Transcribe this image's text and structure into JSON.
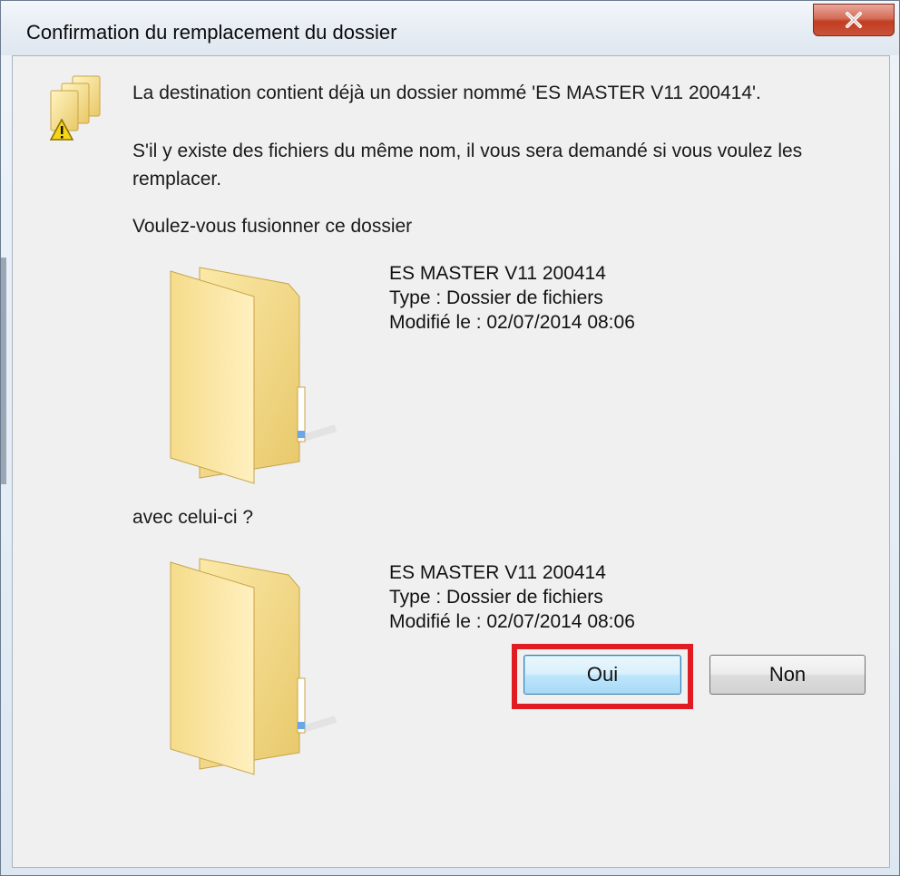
{
  "window": {
    "title": "Confirmation du remplacement du dossier"
  },
  "message": {
    "line1": "La destination contient déjà un dossier nommé 'ES MASTER V11 200414'.",
    "line2a": "S'il y existe des fichiers du même nom, il vous sera demandé si vous voulez les",
    "line2b": "remplacer.",
    "question": "Voulez-vous fusionner ce dossier",
    "with": "avec celui-ci ?"
  },
  "folders": [
    {
      "name": "ES MASTER V11 200414",
      "type": "Type : Dossier de fichiers",
      "modified": "Modifié le : 02/07/2014 08:06"
    },
    {
      "name": "ES MASTER V11 200414",
      "type": "Type : Dossier de fichiers",
      "modified": "Modifié le : 02/07/2014 08:06"
    }
  ],
  "buttons": {
    "yes": "Oui",
    "no": "Non"
  },
  "icons": {
    "close": "close-icon",
    "warning": "warning-folders-icon",
    "folder": "folder-icon"
  },
  "colors": {
    "highlight": "#e01b22",
    "close_button": "#c13d22",
    "default_button_border": "#3c7fb1"
  }
}
